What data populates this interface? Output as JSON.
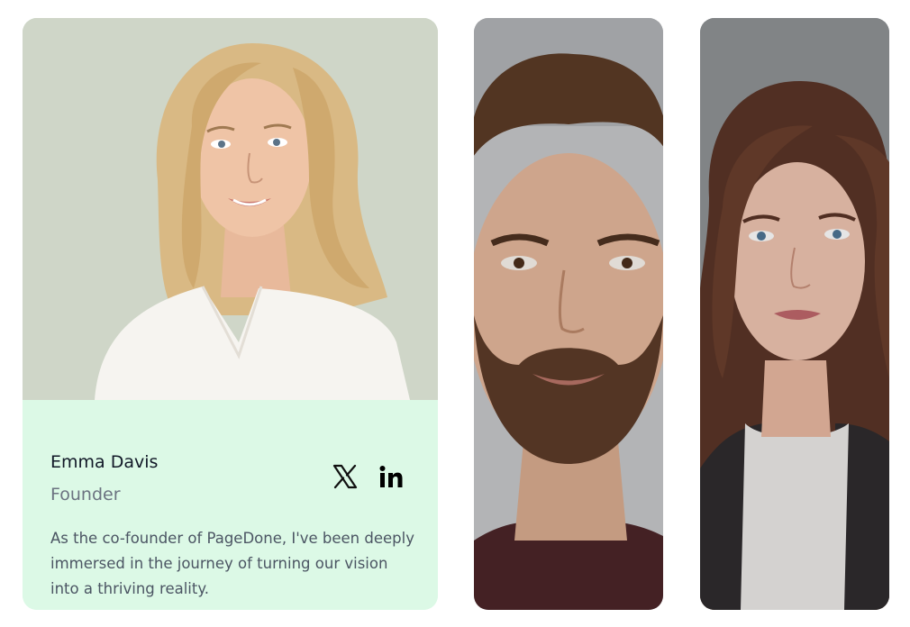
{
  "team": {
    "featured": {
      "name": "Emma Davis",
      "role": "Founder",
      "bio": "As the co-founder of PageDone, I've been deeply immersed in the journey of turning our vision into a thriving reality.",
      "social": [
        {
          "icon": "x-icon",
          "label": "X"
        },
        {
          "icon": "linkedin-icon",
          "label": "in"
        }
      ],
      "card_background": "#dcf9e6"
    },
    "collapsed_members": [
      {
        "photo": "bearded-man-portrait"
      },
      {
        "photo": "brunette-woman-portrait"
      }
    ]
  },
  "colors": {
    "name_text": "#111827",
    "role_text": "#6b7280",
    "bio_text": "#4b5563"
  }
}
